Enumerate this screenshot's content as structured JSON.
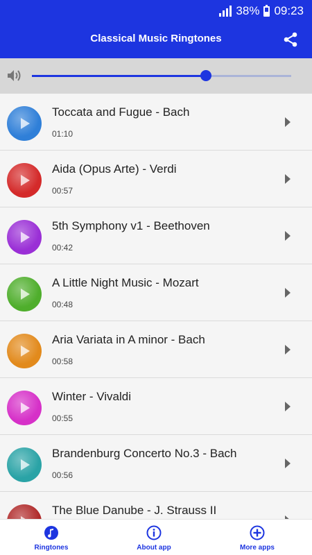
{
  "status_bar": {
    "battery": "38%",
    "time": "09:23"
  },
  "app_bar": {
    "title": "Classical Music Ringtones",
    "share_icon": "share-icon"
  },
  "volume": {
    "icon": "speaker-icon",
    "level": 0.67
  },
  "ringtones": [
    {
      "title": "Toccata and Fugue - Bach",
      "duration": "01:10",
      "color": "#2f7fd8"
    },
    {
      "title": "Aida (Opus Arte) - Verdi",
      "duration": "00:57",
      "color": "#d42a2a"
    },
    {
      "title": "5th Symphony v1 - Beethoven",
      "duration": "00:42",
      "color": "#9a2fd6"
    },
    {
      "title": "A Little Night Music - Mozart",
      "duration": "00:48",
      "color": "#4fae2c"
    },
    {
      "title": "Aria Variata in A minor - Bach",
      "duration": "00:58",
      "color": "#e28a1c"
    },
    {
      "title": "Winter - Vivaldi",
      "duration": "00:55",
      "color": "#d630c8"
    },
    {
      "title": "Brandenburg Concerto No.3 - Bach",
      "duration": "00:56",
      "color": "#2aa3a6"
    },
    {
      "title": "The Blue Danube - J. Strauss II",
      "duration": "",
      "color": "#b02a2a"
    }
  ],
  "bottom_nav": [
    {
      "label": "Ringtones",
      "icon": "music-note-icon"
    },
    {
      "label": "About app",
      "icon": "info-icon"
    },
    {
      "label": "More apps",
      "icon": "plus-circle-icon"
    }
  ],
  "colors": {
    "primary": "#1d35e0"
  }
}
